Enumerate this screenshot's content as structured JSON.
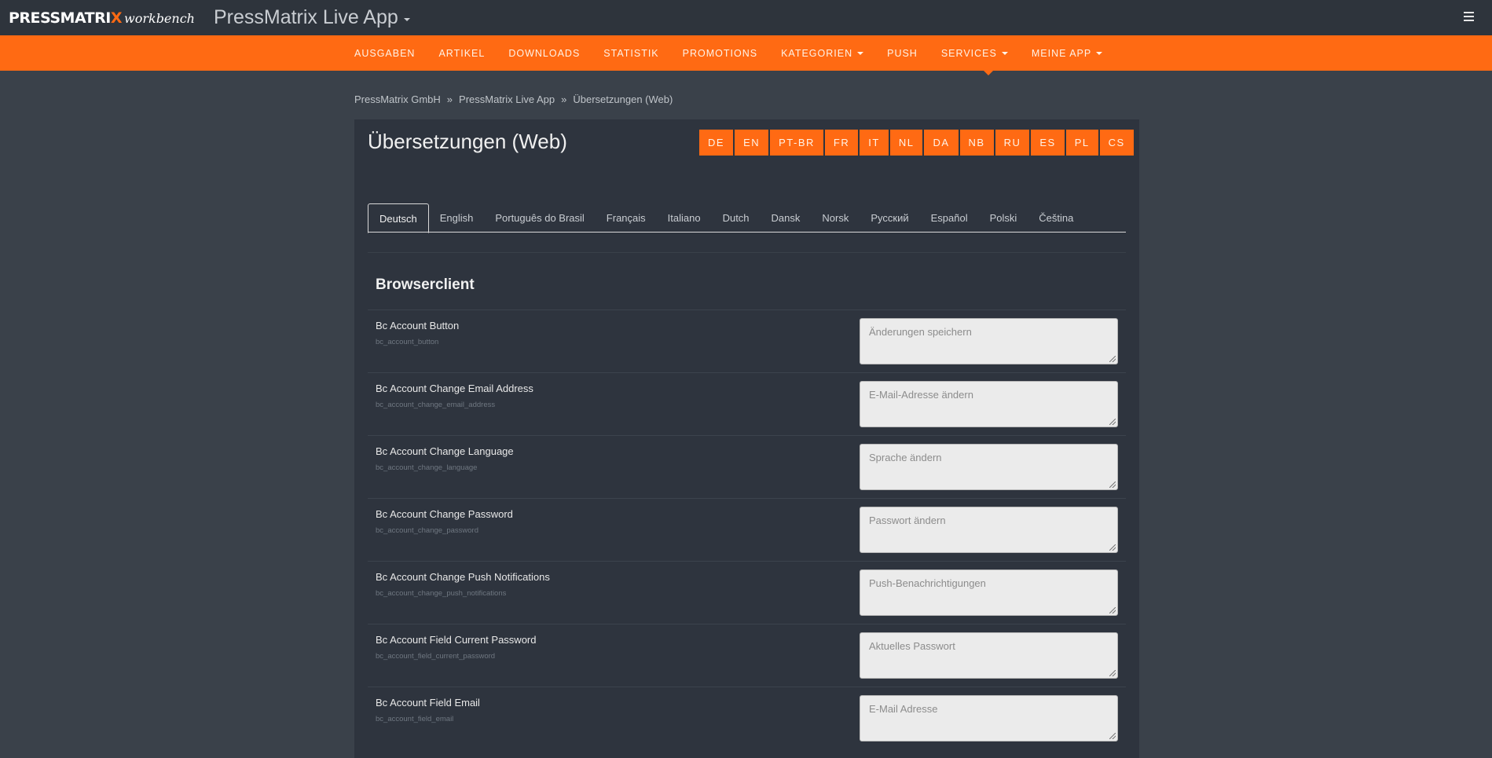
{
  "brand": {
    "logo_text": "PRESSMATRI",
    "logo_x": "X",
    "logo_sub": "workbench",
    "app_title": "PressMatrix Live App"
  },
  "nav": {
    "items": [
      "AUSGABEN",
      "ARTIKEL",
      "DOWNLOADS",
      "STATISTIK",
      "PROMOTIONS",
      "KATEGORIEN",
      "PUSH",
      "SERVICES",
      "MEINE APP"
    ],
    "dropdown_items": [
      "KATEGORIEN",
      "SERVICES",
      "MEINE APP"
    ]
  },
  "breadcrumb": {
    "items": [
      "PressMatrix GmbH",
      "PressMatrix Live App",
      "Übersetzungen (Web)"
    ],
    "separator": "»"
  },
  "page": {
    "title": "Übersetzungen (Web)",
    "lang_buttons": [
      "DE",
      "EN",
      "PT-BR",
      "FR",
      "IT",
      "NL",
      "DA",
      "NB",
      "RU",
      "ES",
      "PL",
      "CS"
    ],
    "tabs": [
      "Deutsch",
      "English",
      "Português do Brasil",
      "Français",
      "Italiano",
      "Dutch",
      "Dansk",
      "Norsk",
      "Русский",
      "Español",
      "Polski",
      "Čeština"
    ],
    "active_tab": "Deutsch",
    "section_title": "Browserclient"
  },
  "rows": [
    {
      "label": "Bc Account Button",
      "key": "bc_account_button",
      "value": "Änderungen speichern"
    },
    {
      "label": "Bc Account Change Email Address",
      "key": "bc_account_change_email_address",
      "value": "E-Mail-Adresse ändern"
    },
    {
      "label": "Bc Account Change Language",
      "key": "bc_account_change_language",
      "value": "Sprache ändern"
    },
    {
      "label": "Bc Account Change Password",
      "key": "bc_account_change_password",
      "value": "Passwort ändern"
    },
    {
      "label": "Bc Account Change Push Notifications",
      "key": "bc_account_change_push_notifications",
      "value": "Push-Benachrichtigungen"
    },
    {
      "label": "Bc Account Field Current Password",
      "key": "bc_account_field_current_password",
      "value": "Aktuelles Passwort"
    },
    {
      "label": "Bc Account Field Email",
      "key": "bc_account_field_email",
      "value": "E-Mail Adresse"
    }
  ],
  "colors": {
    "accent": "#ff6a13",
    "header_bg": "#2e343c",
    "page_bg": "#3a414a",
    "panel_bg": "#2e343e"
  },
  "icons": {
    "menu": "hamburger-menu-icon"
  }
}
